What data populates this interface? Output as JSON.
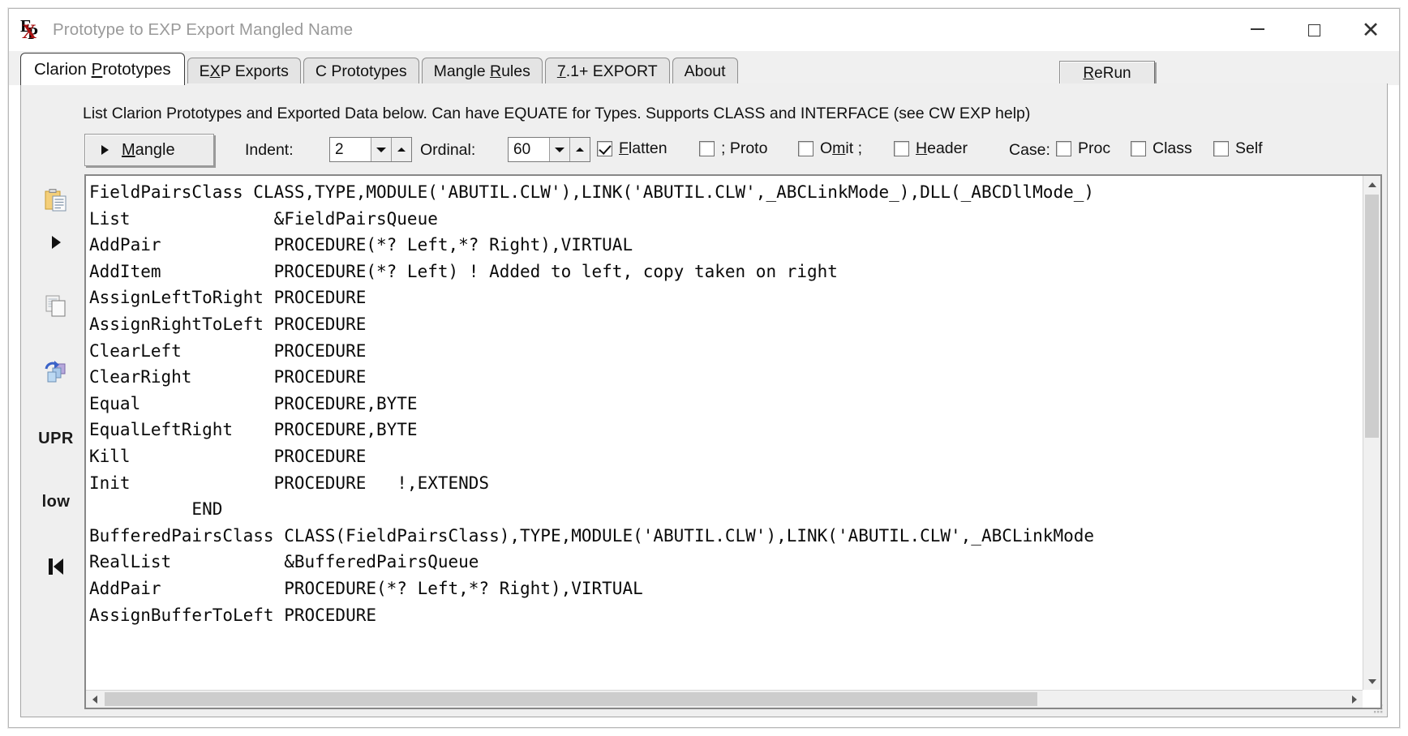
{
  "window": {
    "title": "Prototype to EXP Export Mangled Name",
    "icon": "exp-app-icon",
    "controls": {
      "minimize": "minimize-icon",
      "maximize": "maximize-icon",
      "close": "close-icon"
    }
  },
  "tabs": [
    {
      "label": "Clarion Prototypes",
      "pre": "Clarion ",
      "accel": "P",
      "post": "rototypes",
      "active": true
    },
    {
      "label": "EXP Exports",
      "pre": "E",
      "accel": "X",
      "post": "P Exports",
      "active": false
    },
    {
      "label": "C Prototypes",
      "pre": "C Prototypes",
      "accel": "",
      "post": "",
      "active": false
    },
    {
      "label": "Mangle Rules",
      "pre": "Mangle ",
      "accel": "R",
      "post": "ules",
      "active": false
    },
    {
      "label": "7.1+ EXPORT",
      "pre": "",
      "accel": "7",
      "post": ".1+ EXPORT",
      "active": false
    },
    {
      "label": "About",
      "pre": "About",
      "accel": "",
      "post": "",
      "active": false
    }
  ],
  "rerun": {
    "label": "ReRun",
    "pre": "",
    "accel": "R",
    "post": "eRun"
  },
  "hint": "List Clarion Prototypes and Exported Data below. Can have EQUATE for Types. Supports CLASS and INTERFACE (see CW EXP help)",
  "toolbar": {
    "mangle": {
      "label": "Mangle",
      "pre": "",
      "accel": "M",
      "post": "angle"
    },
    "indent": {
      "label": "Indent:",
      "value": "2"
    },
    "ordinal": {
      "label": "Ordinal:",
      "value": "60"
    },
    "case_label": "Case:",
    "checkboxes": [
      {
        "name": "flatten",
        "label": "Flatten",
        "pre": "",
        "accel": "F",
        "post": "latten",
        "checked": true
      },
      {
        "name": "semi-proto",
        "label": "; Proto",
        "pre": "; Proto",
        "accel": "",
        "post": "",
        "checked": false
      },
      {
        "name": "omit",
        "label": "Omit ;",
        "pre": "O",
        "accel": "m",
        "post": "it ;",
        "checked": false
      },
      {
        "name": "header",
        "label": "Header",
        "pre": "",
        "accel": "H",
        "post": "eader",
        "checked": false
      },
      {
        "name": "proc",
        "label": "Proc",
        "pre": "Proc",
        "accel": "",
        "post": "",
        "checked": false
      },
      {
        "name": "class",
        "label": "Class",
        "pre": "Class",
        "accel": "",
        "post": "",
        "checked": false
      },
      {
        "name": "self",
        "label": "Self",
        "pre": "Self",
        "accel": "",
        "post": "",
        "checked": false
      }
    ]
  },
  "rail": [
    {
      "name": "paste-icon",
      "type": "icon",
      "label": ""
    },
    {
      "name": "run-icon",
      "type": "triangle",
      "label": ""
    },
    {
      "name": "copy-icon",
      "type": "icon",
      "label": ""
    },
    {
      "name": "refresh-swap-icon",
      "type": "icon",
      "label": ""
    },
    {
      "name": "uppercase-button",
      "type": "text",
      "label": "UPR"
    },
    {
      "name": "lowercase-button",
      "type": "text",
      "label": "low"
    },
    {
      "name": "goto-start-icon",
      "type": "skip",
      "label": ""
    }
  ],
  "editor": {
    "lines": [
      "FieldPairsClass CLASS,TYPE,MODULE('ABUTIL.CLW'),LINK('ABUTIL.CLW',_ABCLinkMode_),DLL(_ABCDllMode_)",
      "List              &FieldPairsQueue",
      "AddPair           PROCEDURE(*? Left,*? Right),VIRTUAL",
      "AddItem           PROCEDURE(*? Left) ! Added to left, copy taken on right",
      "AssignLeftToRight PROCEDURE",
      "AssignRightToLeft PROCEDURE",
      "ClearLeft         PROCEDURE",
      "ClearRight        PROCEDURE",
      "Equal             PROCEDURE,BYTE",
      "EqualLeftRight    PROCEDURE,BYTE",
      "Kill              PROCEDURE",
      "Init              PROCEDURE   !,EXTENDS",
      "          END",
      "BufferedPairsClass CLASS(FieldPairsClass),TYPE,MODULE('ABUTIL.CLW'),LINK('ABUTIL.CLW',_ABCLinkMode",
      "RealList           &BufferedPairsQueue",
      "AddPair            PROCEDURE(*? Left,*? Right),VIRTUAL",
      "AssignBufferToLeft PROCEDURE"
    ]
  },
  "scrollbars": {
    "vertical": {
      "up": "scroll-up-icon",
      "down": "scroll-down-icon"
    },
    "horizontal": {
      "left": "scroll-left-icon",
      "right": "scroll-right-icon"
    }
  }
}
